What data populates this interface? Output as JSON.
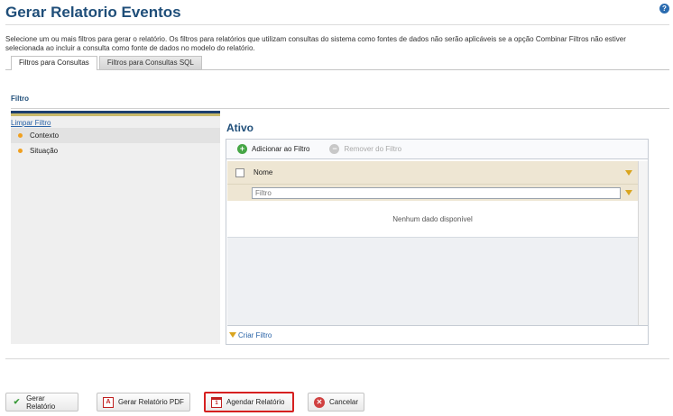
{
  "header": {
    "title": "Gerar Relatorio Eventos",
    "help_icon": "?",
    "intro": "Selecione um ou mais filtros para gerar o relatório. Os filtros para relatórios que utilizam consultas do sistema como fontes de dados não serão aplicáveis se a opção Combinar Filtros não estiver selecionada ao incluir a consulta como fonte de dados no modelo do relatório."
  },
  "tabs": [
    {
      "label": "Filtros para Consultas",
      "active": true
    },
    {
      "label": "Filtros para Consultas SQL",
      "active": false
    }
  ],
  "filter_section": {
    "label": "Filtro",
    "clear_link": "Limpar Filtro",
    "items": [
      {
        "label": "Contexto",
        "selected": true
      },
      {
        "label": "Situação",
        "selected": false
      }
    ]
  },
  "active_panel": {
    "title": "Ativo",
    "toolbar": {
      "add_label": "Adicionar ao Filtro",
      "remove_label": "Remover do Filtro"
    },
    "grid": {
      "column_name": "Nome",
      "filter_placeholder": "Filtro",
      "empty_text": "Nenhum dado disponível"
    },
    "create_filter_link": "Criar Filtro"
  },
  "actions": {
    "generate_report": "Gerar Relatório",
    "generate_pdf": "Gerar Relatório PDF",
    "schedule_report": "Agendar Relatório",
    "cancel": "Cancelar"
  },
  "colors": {
    "title": "#1f4e79",
    "link": "#2a64a8",
    "accent_bullet": "#f0a020",
    "highlight_border": "#d62020"
  }
}
